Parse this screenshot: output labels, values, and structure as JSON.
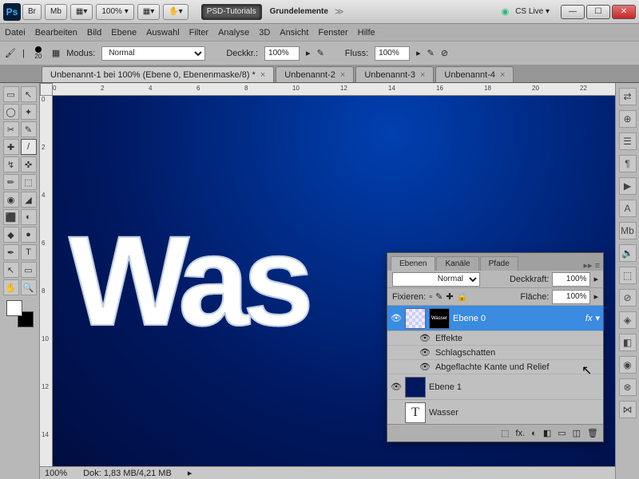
{
  "titlebar": {
    "app_abbr": "Ps",
    "btns": [
      "Br",
      "Mb",
      "▦▾",
      "100% ▾",
      "▦▾",
      "✋▾"
    ],
    "center_dark": "PSD-Tutorials",
    "center_light": "Grundelemente",
    "cslive": "CS Live ▾"
  },
  "menu": [
    "Datei",
    "Bearbeiten",
    "Bild",
    "Ebene",
    "Auswahl",
    "Filter",
    "Analyse",
    "3D",
    "Ansicht",
    "Fenster",
    "Hilfe"
  ],
  "options": {
    "brush_size": "20",
    "mode_label": "Modus:",
    "mode_value": "Normal",
    "opacity_label": "Deckkr.:",
    "opacity_value": "100%",
    "flow_label": "Fluss:",
    "flow_value": "100%"
  },
  "tabs": [
    {
      "label": "Unbenannt-1 bei 100% (Ebene 0, Ebenenmaske/8) *",
      "active": true
    },
    {
      "label": "Unbenannt-2",
      "active": false
    },
    {
      "label": "Unbenannt-3",
      "active": false
    },
    {
      "label": "Unbenannt-4",
      "active": false
    }
  ],
  "ruler_h": [
    "0",
    "2",
    "4",
    "6",
    "8",
    "10",
    "12",
    "14",
    "16",
    "18",
    "20",
    "22"
  ],
  "ruler_v": [
    "0",
    "2",
    "4",
    "6",
    "8",
    "10",
    "12",
    "14"
  ],
  "canvas_text": "Was",
  "status": {
    "zoom": "100%",
    "doc": "Dok: 1,83 MB/4,21 MB"
  },
  "layers_panel": {
    "tabs": [
      "Ebenen",
      "Kanäle",
      "Pfade"
    ],
    "blend": "Normal",
    "opacity_label": "Deckkraft:",
    "opacity": "100%",
    "lock_label": "Fixieren:",
    "fill_label": "Fläche:",
    "fill": "100%",
    "layers": [
      {
        "name": "Ebene 0",
        "selected": true,
        "fx": "fx",
        "visible": true,
        "thumbs": [
          "pattern",
          "mask"
        ]
      },
      {
        "effects_header": "Effekte"
      },
      {
        "effect": "Schlagschatten"
      },
      {
        "effect": "Abgeflachte Kante und Relief"
      },
      {
        "name": "Ebene 1",
        "visible": true,
        "thumbs": [
          "dark"
        ]
      },
      {
        "name": "Wasser",
        "visible": false,
        "thumbs": [
          "T"
        ]
      }
    ],
    "footer_icons": [
      "⬚",
      "fx.",
      "◐",
      "◧",
      "▭",
      "◫",
      "🗑"
    ]
  },
  "tools": [
    "▭",
    "↖",
    "◯",
    "✦",
    "✂",
    "✎",
    "✚",
    "/",
    "↯",
    "✜",
    "✏",
    "⬚",
    "◉",
    "◢",
    "⬛",
    "◐",
    "◆",
    "●",
    "✒",
    "T",
    "↖",
    "▭",
    "✋",
    "🔍"
  ],
  "dock_icons": [
    "⇄",
    "⊕",
    "☰",
    "¶",
    "▶",
    "A",
    "Mb",
    "🔉",
    "⬚",
    "⊘",
    "◈",
    "◧",
    "◉",
    "⊗",
    "⋈"
  ]
}
